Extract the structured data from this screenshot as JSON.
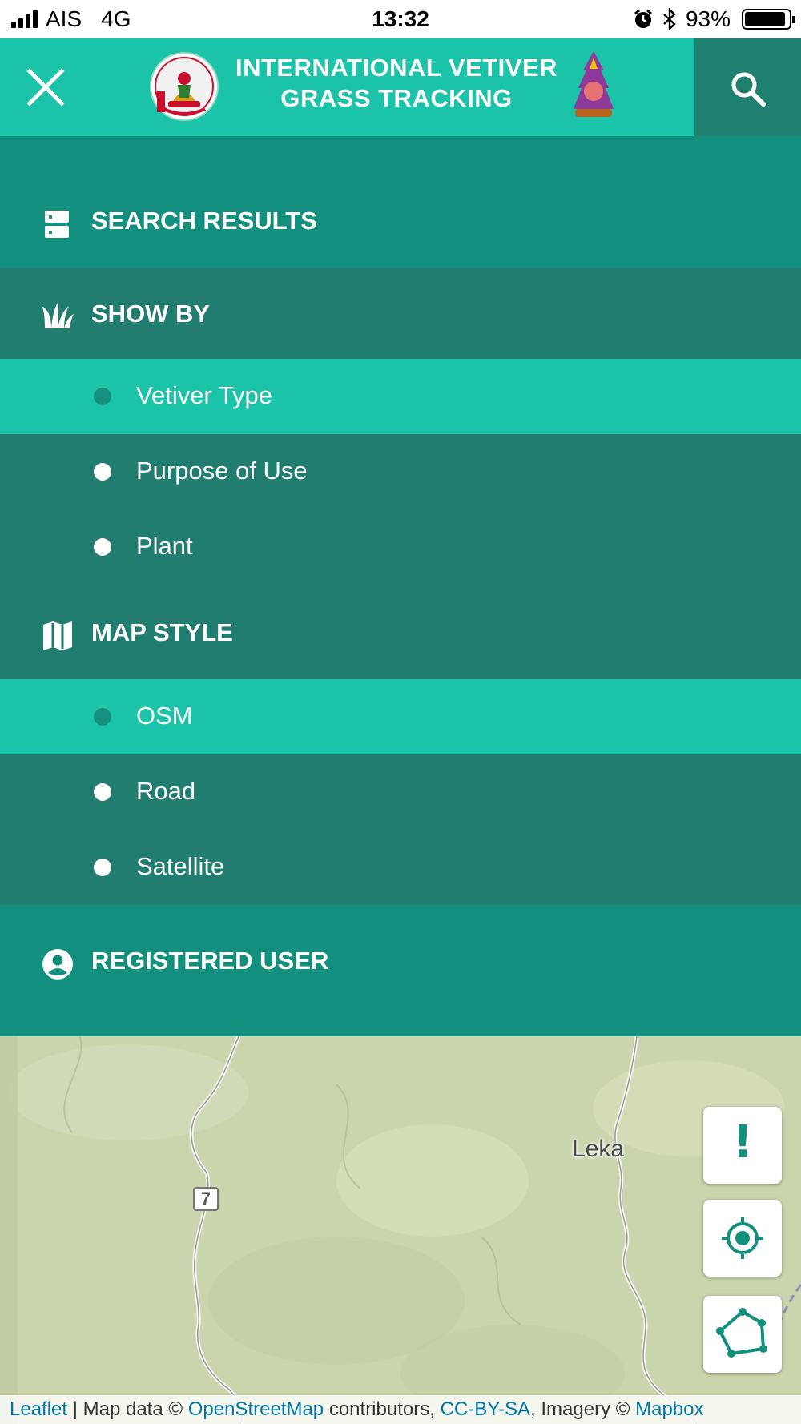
{
  "status_bar": {
    "carrier": "AIS",
    "network": "4G",
    "time": "13:32",
    "battery": "93%",
    "battery_level": 0.93
  },
  "header": {
    "title_line1": "INTERNATIONAL VETIVER",
    "title_line2": "GRASS TRACKING",
    "icons": {
      "close": "close-icon",
      "search": "search-icon"
    }
  },
  "drawer": {
    "search_results": {
      "label": "SEARCH RESULTS",
      "icon": "list-icon"
    },
    "show_by": {
      "label": "SHOW BY",
      "icon": "grass-icon",
      "options": [
        {
          "label": "Vetiver Type",
          "selected": true
        },
        {
          "label": "Purpose of Use",
          "selected": false
        },
        {
          "label": "Plant",
          "selected": false
        }
      ]
    },
    "map_style": {
      "label": "MAP STYLE",
      "icon": "map-icon",
      "options": [
        {
          "label": "OSM",
          "selected": true
        },
        {
          "label": "Road",
          "selected": false
        },
        {
          "label": "Satellite",
          "selected": false
        }
      ]
    },
    "registered_user": {
      "label": "REGISTERED USER",
      "icon": "account-circle-icon"
    }
  },
  "map": {
    "place_label": "Leka",
    "route_number": "7",
    "buttons": {
      "alert": "!",
      "locate": "crosshair-icon",
      "draw": "polygon-icon"
    },
    "attribution": {
      "leaflet": "Leaflet",
      "sep": " | Map data © ",
      "osm": "OpenStreetMap",
      "contributors": " contributors, ",
      "license": "CC-BY-SA",
      "imagery": ", Imagery © ",
      "mapbox": "Mapbox"
    }
  },
  "colors": {
    "accent": "#1bc3a8",
    "drawer": "#13907d",
    "drawer_dark": "#217d6f",
    "link": "#0078a8"
  }
}
